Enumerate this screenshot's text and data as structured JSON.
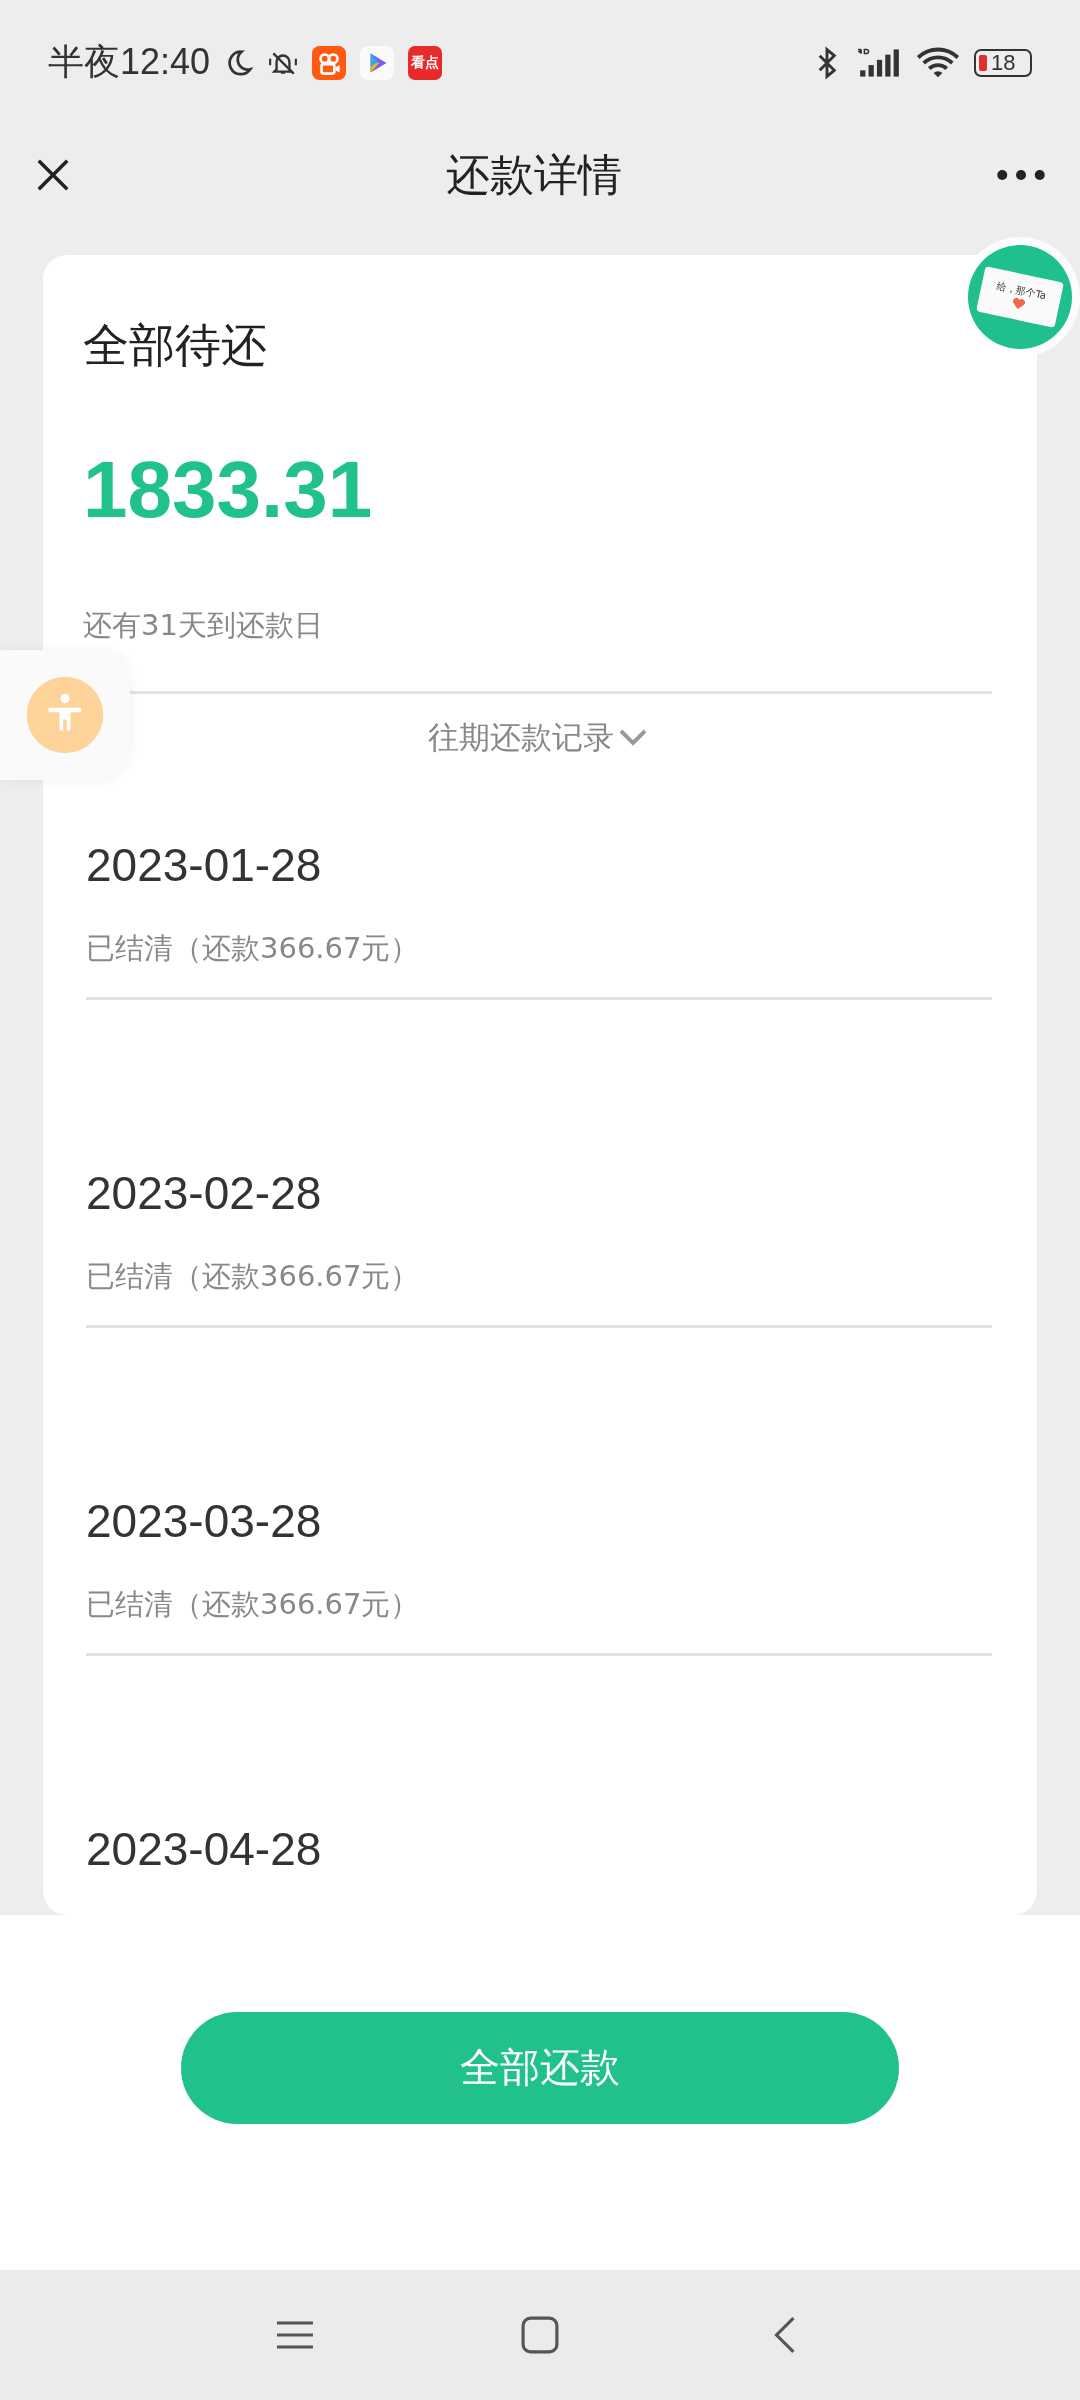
{
  "status_bar": {
    "time": "半夜12:40",
    "app_label": "看点",
    "battery": "18"
  },
  "header": {
    "title": "还款详情"
  },
  "summary": {
    "label": "全部待还",
    "amount": "1833.31",
    "note": "还有31天到还款日",
    "history_link": "往期还款记录"
  },
  "records": [
    {
      "date": "2023-01-28",
      "status": "已结清（还款366.67元）"
    },
    {
      "date": "2023-02-28",
      "status": "已结清（还款366.67元）"
    },
    {
      "date": "2023-03-28",
      "status": "已结清（还款366.67元）"
    },
    {
      "date": "2023-04-28"
    }
  ],
  "floating_badge": {
    "text": "给，那个Ta"
  },
  "pay_button": {
    "label": "全部还款"
  }
}
